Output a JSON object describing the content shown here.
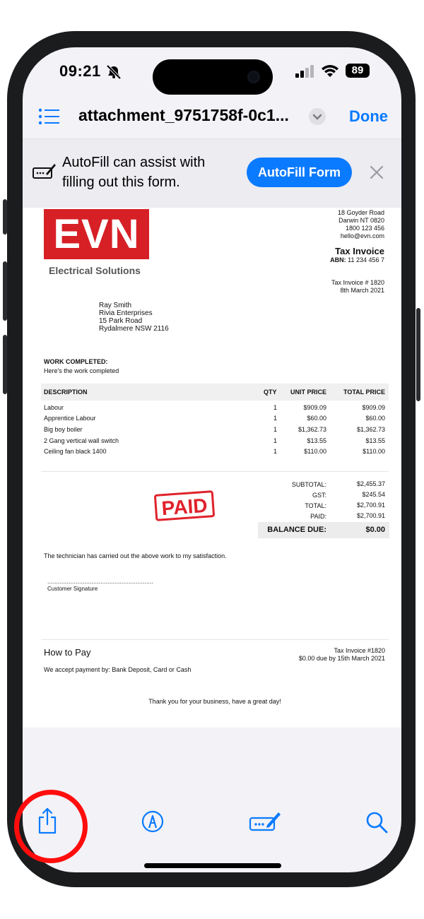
{
  "status_bar": {
    "time": "09:21",
    "battery": "89"
  },
  "nav": {
    "title": "attachment_9751758f-0c1...",
    "done_label": "Done"
  },
  "autofill": {
    "message": "AutoFill can assist with filling out this form.",
    "button_label": "AutoFill Form"
  },
  "invoice": {
    "logo_text": "EVN",
    "logo_subtitle": "Electrical Solutions",
    "company_address": [
      "18 Goyder Road",
      "Darwin NT 0820",
      "1800 123 456",
      "hello@evn.com"
    ],
    "doc_type": "Tax Invoice",
    "abn_label": "ABN:",
    "abn": "11 234 456 7",
    "invoice_number": "Tax Invoice # 1820",
    "invoice_date": "8th March 2021",
    "customer": [
      "Ray Smith",
      "Rivia Enterprises",
      "15 Park Road",
      "Rydalmere NSW 2116"
    ],
    "work_heading": "WORK COMPLETED:",
    "work_text": "Here's the work completed",
    "columns": [
      "DESCRIPTION",
      "QTY",
      "UNIT PRICE",
      "TOTAL PRICE"
    ],
    "items": [
      {
        "desc": "Labour",
        "qty": "1",
        "unit": "$909.09",
        "total": "$909.09"
      },
      {
        "desc": "Apprentice Labour",
        "qty": "1",
        "unit": "$60.00",
        "total": "$60.00"
      },
      {
        "desc": "Big boy boiler",
        "qty": "1",
        "unit": "$1,362.73",
        "total": "$1,362.73"
      },
      {
        "desc": "2 Gang vertical wall switch",
        "qty": "1",
        "unit": "$13.55",
        "total": "$13.55"
      },
      {
        "desc": "Ceiling fan black 1400",
        "qty": "1",
        "unit": "$110.00",
        "total": "$110.00"
      }
    ],
    "totals": [
      {
        "label": "SUBTOTAL:",
        "value": "$2,455.37"
      },
      {
        "label": "GST:",
        "value": "$245.54"
      },
      {
        "label": "TOTAL:",
        "value": "$2,700.91"
      },
      {
        "label": "PAID:",
        "value": "$2,700.91"
      }
    ],
    "balance_label": "BALANCE DUE:",
    "balance_value": "$0.00",
    "stamp": "PAID",
    "statement": "The technician has carried out the above work to my satisfaction.",
    "signature_dots": "............................................................",
    "signature_label": "Customer Signature",
    "how_to_pay": "How to Pay",
    "payment_methods": "We accept payment by: Bank Deposit, Card or Cash",
    "footer_invoice": "Tax Invoice #1820",
    "footer_due": "$0.00 due by 15th March 2021",
    "thanks": "Thank you for your business, have a great day!"
  },
  "toolbar": {
    "icons": [
      "share-icon",
      "markup-icon",
      "autofill-icon",
      "search-icon"
    ]
  },
  "colors": {
    "accent": "#0a7aff",
    "brand_red": "#d71f26",
    "highlight_ring": "#ff0d0d"
  }
}
